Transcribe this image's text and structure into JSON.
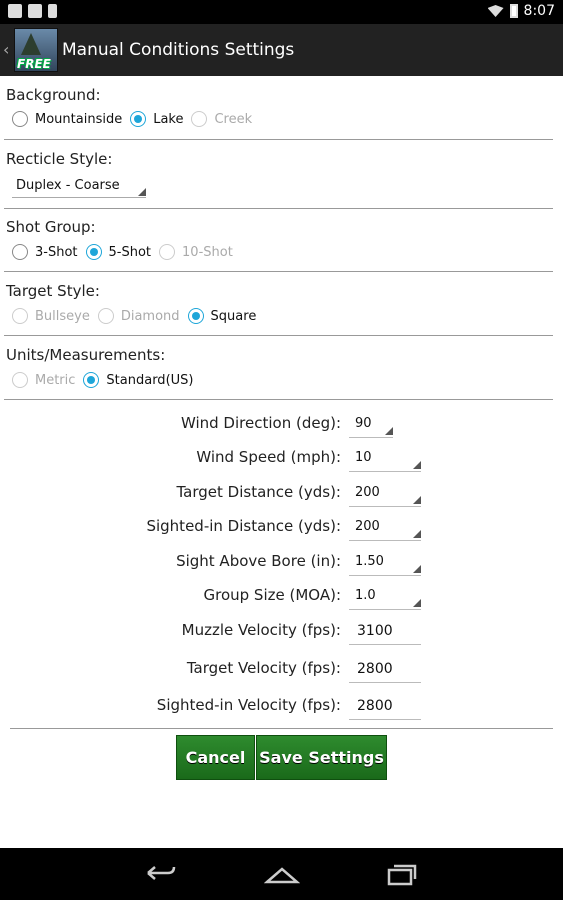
{
  "status": {
    "time": "8:07"
  },
  "header": {
    "title": "Manual Conditions Settings",
    "badge": "FREE"
  },
  "background": {
    "label": "Background:",
    "options": [
      {
        "label": "Mountainside",
        "checked": false,
        "enabled": true
      },
      {
        "label": "Lake",
        "checked": true,
        "enabled": true
      },
      {
        "label": "Creek",
        "checked": false,
        "enabled": false
      }
    ]
  },
  "reticle": {
    "label": "Recticle Style:",
    "value": "Duplex - Coarse"
  },
  "shot_group": {
    "label": "Shot Group:",
    "options": [
      {
        "label": "3-Shot",
        "checked": false,
        "enabled": true
      },
      {
        "label": "5-Shot",
        "checked": true,
        "enabled": true
      },
      {
        "label": "10-Shot",
        "checked": false,
        "enabled": false
      }
    ]
  },
  "target_style": {
    "label": "Target Style:",
    "options": [
      {
        "label": "Bullseye",
        "checked": false,
        "enabled": false
      },
      {
        "label": "Diamond",
        "checked": false,
        "enabled": false
      },
      {
        "label": "Square",
        "checked": true,
        "enabled": true
      }
    ]
  },
  "units": {
    "label": "Units/Measurements:",
    "options": [
      {
        "label": "Metric",
        "checked": false,
        "enabled": false
      },
      {
        "label": "Standard(US)",
        "checked": true,
        "enabled": true
      }
    ]
  },
  "fields": [
    {
      "label": "Wind Direction (deg):",
      "value": "90",
      "type": "spinner"
    },
    {
      "label": "Wind Speed (mph):",
      "value": "10",
      "type": "spinner"
    },
    {
      "label": "Target Distance (yds):",
      "value": "200",
      "type": "spinner"
    },
    {
      "label": "Sighted-in Distance (yds):",
      "value": "200",
      "type": "spinner"
    },
    {
      "label": "Sight Above Bore (in):",
      "value": "1.50",
      "type": "spinner"
    },
    {
      "label": "Group Size (MOA):",
      "value": "1.0",
      "type": "spinner"
    },
    {
      "label": "Muzzle Velocity (fps):",
      "value": "3100",
      "type": "input"
    },
    {
      "label": "Target Velocity (fps):",
      "value": "2800",
      "type": "input"
    },
    {
      "label": "Sighted-in Velocity (fps):",
      "value": "2800",
      "type": "input"
    }
  ],
  "buttons": {
    "cancel": "Cancel",
    "save": "Save Settings"
  },
  "colors": {
    "accent": "#1ea6d9",
    "button_green": "#2e8b2e",
    "actionbar": "#222222"
  }
}
